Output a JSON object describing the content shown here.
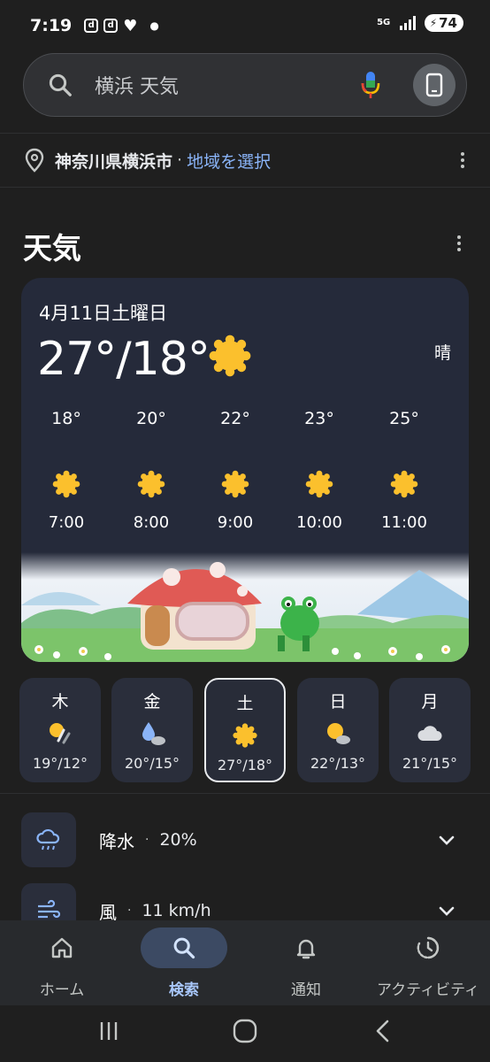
{
  "status_bar": {
    "time": "7:19",
    "app_badge_1": "d",
    "app_badge_2": "d",
    "network": "5G",
    "battery": "74"
  },
  "search": {
    "query": "横浜 天気"
  },
  "location": {
    "place": "神奈川県横浜市",
    "separator": "·",
    "select_link": "地域を選択"
  },
  "section": {
    "title": "天気"
  },
  "current": {
    "date": "4月11日土曜日",
    "temps": "27°/18°",
    "condition": "晴",
    "icon": "sun-icon"
  },
  "hourly": [
    {
      "temp": "18°",
      "time": "7:00",
      "icon": "sun-icon"
    },
    {
      "temp": "20°",
      "time": "8:00",
      "icon": "sun-icon"
    },
    {
      "temp": "22°",
      "time": "9:00",
      "icon": "sun-icon"
    },
    {
      "temp": "23°",
      "time": "10:00",
      "icon": "sun-icon"
    },
    {
      "temp": "25°",
      "time": "11:00",
      "icon": "sun-icon"
    }
  ],
  "days": [
    {
      "day": "木",
      "temps": "19°/12°",
      "icon": "sun-rain-icon"
    },
    {
      "day": "金",
      "temps": "20°/15°",
      "icon": "raindrop-cloud-icon"
    },
    {
      "day": "土",
      "temps": "27°/18°",
      "icon": "sun-icon",
      "selected": true
    },
    {
      "day": "日",
      "temps": "22°/13°",
      "icon": "sun-cloud-icon"
    },
    {
      "day": "月",
      "temps": "21°/15°",
      "icon": "cloud-icon"
    }
  ],
  "details": [
    {
      "label": "降水",
      "dot": "·",
      "value": "20%",
      "icon": "rain-cloud-icon"
    },
    {
      "label": "風",
      "dot": "·",
      "value": "11 km/h",
      "icon": "wind-icon"
    }
  ],
  "nav": {
    "home": "ホーム",
    "search": "検索",
    "notifications": "通知",
    "activity": "アクティビティ"
  },
  "colors": {
    "background": "#1f1f1f",
    "card": "#252a3a",
    "sun": "#fbc02d",
    "link": "#8ab4f8",
    "nav_active": "#a8c7fa"
  }
}
